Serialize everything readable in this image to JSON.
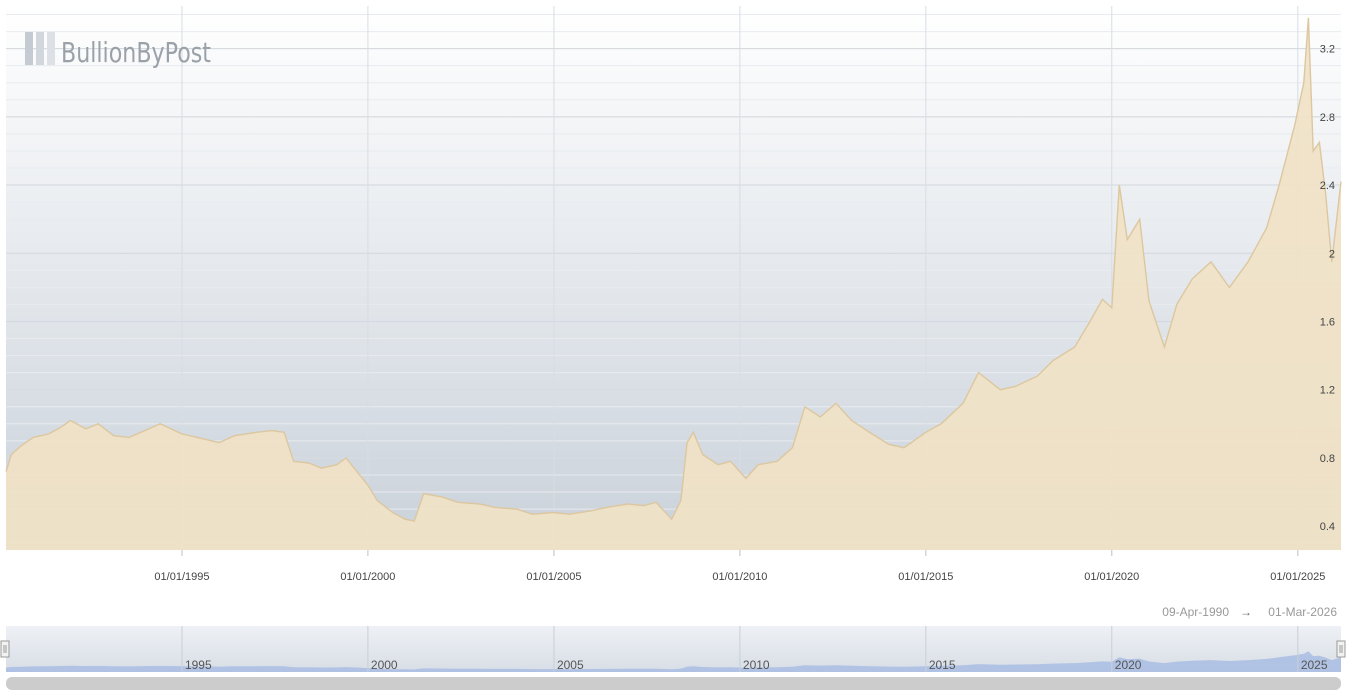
{
  "brand": {
    "name": "BullionByPost"
  },
  "navigator": {
    "range_start": "09-Apr-1990",
    "arrow": "→",
    "range_end": "01-Mar-2026"
  },
  "colors": {
    "area_fill": "#f0e2c6",
    "area_stroke": "#dcc79f",
    "bg_top": "#ffffff",
    "bg_bottom": "#c9d1da",
    "nav_fill": "#a9bde3"
  },
  "chart_data": {
    "type": "area",
    "title": "",
    "xlabel": "",
    "ylabel": "",
    "x_ticks": [
      "01/01/1995",
      "01/01/2000",
      "01/01/2005",
      "01/01/2010",
      "01/01/2015",
      "01/01/2020",
      "01/01/2025"
    ],
    "y_ticks": [
      0.4,
      0.8,
      1.2,
      1.6,
      2,
      2.4,
      2.8,
      3.2
    ],
    "ylim": [
      0.26,
      3.45
    ],
    "xlim": [
      "1990-04-09",
      "2026-03-01"
    ],
    "grid": true,
    "y_axis_side": "right",
    "navigator_labels": [
      "1995",
      "2000",
      "2005",
      "2010",
      "2015",
      "2020",
      "2025"
    ],
    "series": [
      {
        "values": [
          [
            "1990-04-09",
            0.72
          ],
          [
            "1990-06-01",
            0.82
          ],
          [
            "1990-09-01",
            0.87
          ],
          [
            "1991-01-01",
            0.92
          ],
          [
            "1991-06-01",
            0.94
          ],
          [
            "1991-10-01",
            0.98
          ],
          [
            "1992-01-01",
            1.02
          ],
          [
            "1992-06-01",
            0.97
          ],
          [
            "1992-10-01",
            1.0
          ],
          [
            "1993-03-01",
            0.93
          ],
          [
            "1993-08-01",
            0.92
          ],
          [
            "1994-01-01",
            0.96
          ],
          [
            "1994-06-01",
            1.0
          ],
          [
            "1995-01-01",
            0.94
          ],
          [
            "1995-06-01",
            0.92
          ],
          [
            "1996-01-01",
            0.89
          ],
          [
            "1996-06-01",
            0.93
          ],
          [
            "1997-01-01",
            0.95
          ],
          [
            "1997-06-01",
            0.96
          ],
          [
            "1997-10-01",
            0.95
          ],
          [
            "1998-01-01",
            0.78
          ],
          [
            "1998-06-01",
            0.77
          ],
          [
            "1998-10-01",
            0.74
          ],
          [
            "1999-03-01",
            0.76
          ],
          [
            "1999-06-01",
            0.8
          ],
          [
            "1999-09-01",
            0.73
          ],
          [
            "2000-01-01",
            0.64
          ],
          [
            "2000-04-01",
            0.55
          ],
          [
            "2000-09-01",
            0.48
          ],
          [
            "2001-01-01",
            0.44
          ],
          [
            "2001-04-01",
            0.43
          ],
          [
            "2001-07-01",
            0.59
          ],
          [
            "2002-01-01",
            0.57
          ],
          [
            "2002-06-01",
            0.54
          ],
          [
            "2003-01-01",
            0.53
          ],
          [
            "2003-06-01",
            0.51
          ],
          [
            "2004-01-01",
            0.5
          ],
          [
            "2004-06-01",
            0.47
          ],
          [
            "2005-01-01",
            0.48
          ],
          [
            "2005-06-01",
            0.47
          ],
          [
            "2006-01-01",
            0.49
          ],
          [
            "2006-06-01",
            0.51
          ],
          [
            "2007-01-01",
            0.53
          ],
          [
            "2007-06-01",
            0.52
          ],
          [
            "2007-10-01",
            0.54
          ],
          [
            "2008-03-01",
            0.44
          ],
          [
            "2008-06-01",
            0.55
          ],
          [
            "2008-08-01",
            0.89
          ],
          [
            "2008-10-01",
            0.95
          ],
          [
            "2009-01-01",
            0.82
          ],
          [
            "2009-06-01",
            0.76
          ],
          [
            "2009-10-01",
            0.78
          ],
          [
            "2010-03-01",
            0.68
          ],
          [
            "2010-07-01",
            0.76
          ],
          [
            "2011-01-01",
            0.78
          ],
          [
            "2011-06-01",
            0.86
          ],
          [
            "2011-10-01",
            1.1
          ],
          [
            "2012-03-01",
            1.04
          ],
          [
            "2012-08-01",
            1.12
          ],
          [
            "2013-01-01",
            1.02
          ],
          [
            "2013-06-01",
            0.96
          ],
          [
            "2014-01-01",
            0.88
          ],
          [
            "2014-06-01",
            0.86
          ],
          [
            "2015-01-01",
            0.95
          ],
          [
            "2015-06-01",
            1.0
          ],
          [
            "2016-01-01",
            1.12
          ],
          [
            "2016-06-01",
            1.3
          ],
          [
            "2017-01-01",
            1.2
          ],
          [
            "2017-06-01",
            1.22
          ],
          [
            "2018-01-01",
            1.28
          ],
          [
            "2018-06-01",
            1.37
          ],
          [
            "2019-01-01",
            1.45
          ],
          [
            "2019-06-01",
            1.6
          ],
          [
            "2019-10-01",
            1.73
          ],
          [
            "2020-01-01",
            1.68
          ],
          [
            "2020-03-15",
            2.4
          ],
          [
            "2020-06-01",
            2.08
          ],
          [
            "2020-10-01",
            2.2
          ],
          [
            "2021-01-01",
            1.72
          ],
          [
            "2021-06-01",
            1.45
          ],
          [
            "2021-10-01",
            1.7
          ],
          [
            "2022-03-01",
            1.85
          ],
          [
            "2022-09-01",
            1.95
          ],
          [
            "2023-03-01",
            1.8
          ],
          [
            "2023-09-01",
            1.95
          ],
          [
            "2024-03-01",
            2.15
          ],
          [
            "2024-07-01",
            2.4
          ],
          [
            "2024-12-01",
            2.75
          ],
          [
            "2025-03-01",
            3.0
          ],
          [
            "2025-04-15",
            3.38
          ],
          [
            "2025-06-01",
            2.6
          ],
          [
            "2025-08-01",
            2.65
          ],
          [
            "2025-10-01",
            2.35
          ],
          [
            "2025-12-01",
            1.95
          ],
          [
            "2026-03-01",
            2.42
          ]
        ]
      }
    ]
  }
}
